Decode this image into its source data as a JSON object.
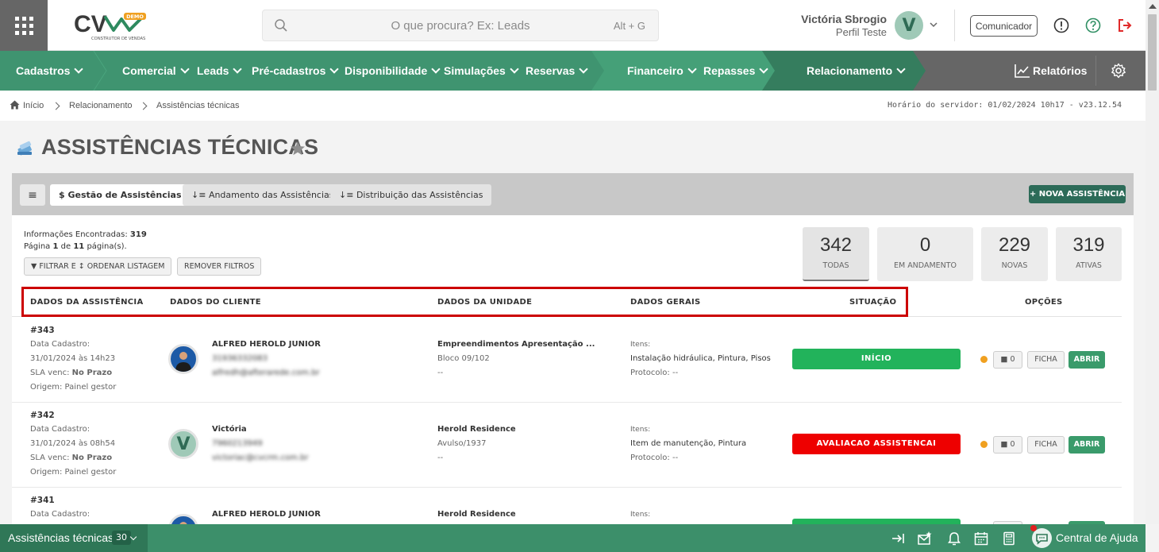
{
  "header": {
    "logo_text": "CV",
    "logo_badge": "DEMO",
    "logo_subtitle": "CONSTRUTOR DE VENDAS",
    "search_placeholder": "O que procura? Ex: Leads",
    "search_shortcut": "Alt + G",
    "user_name": "Victória Sbrogio",
    "user_profile": "Perfil Teste",
    "avatar_letter": "V",
    "communicator_label": "Comunicador"
  },
  "nav": {
    "items": [
      "Cadastros",
      "Comercial",
      "Leads",
      "Pré-cadastros",
      "Disponibilidade",
      "Simulações",
      "Reservas",
      "Financeiro",
      "Repasses",
      "Relacionamento"
    ],
    "reports_label": "Relatórios",
    "colors": {
      "green_main": "#3f9470",
      "green_light": "#45a078",
      "green_dark": "#357d5e",
      "gray": "#666666"
    }
  },
  "breadcrumb": {
    "items": [
      "Início",
      "Relacionamento",
      "Assistências técnicas"
    ],
    "server_time": "Horário do servidor: 01/02/2024 10h17 - v23.12.54"
  },
  "page": {
    "title": "ASSISTÊNCIAS TÉCNICAS"
  },
  "tabs": {
    "items": [
      "$ Gestão de Assistências",
      "Andamento das Assistências",
      "Distribuição das Assistências"
    ],
    "new_button": "+ NOVA ASSISTÊNCIA"
  },
  "summary": {
    "found_label": "Informações Encontradas:",
    "found_count": "319",
    "page_word": "Página",
    "page_current": "1",
    "of_word": "de",
    "page_total": "11",
    "pages_suffix": "página(s).",
    "filter_button": "FILTRAR E ↕ ORDENAR LISTAGEM",
    "remove_filters": "REMOVER FILTROS"
  },
  "stats": [
    {
      "value": "342",
      "label": "TODAS"
    },
    {
      "value": "0",
      "label": "EM ANDAMENTO"
    },
    {
      "value": "229",
      "label": "NOVAS"
    },
    {
      "value": "319",
      "label": "ATIVAS"
    }
  ],
  "table": {
    "headers": {
      "assistance": "DADOS DA ASSISTÊNCIA",
      "client": "DADOS DO CLIENTE",
      "unit": "DADOS DA UNIDADE",
      "general": "DADOS GERAIS",
      "status": "SITUAÇÃO",
      "options": "OPÇÕES"
    },
    "labels": {
      "cadastro": "Data Cadastro:",
      "sla": "SLA venc:",
      "items": "Itens:",
      "protocol": "Protocolo:",
      "ficha": "FICHA",
      "abrir": "ABRIR"
    },
    "rows": [
      {
        "id": "#343",
        "date": "31/01/2024 às 14h23",
        "sla": "No Prazo",
        "origin": "Origem: Painel gestor",
        "client_name": "ALFRED HEROLD JUNIOR",
        "client_phone": "31936332083",
        "client_email": "alfredh@afterarede.com.br",
        "avatar": "photo",
        "unit_name": "Empreendimentos Apresentação ...",
        "unit_block": "Bloco 09/102",
        "unit_extra": "--",
        "items": "Instalação hidráulica, Pintura, Pisos",
        "protocol": "--",
        "status": "INÍCIO",
        "status_color": "#22b35b",
        "comments": "0"
      },
      {
        "id": "#342",
        "date": "31/01/2024 às 08h54",
        "sla": "No Prazo",
        "origin": "Origem: Painel gestor",
        "client_name": "Victória",
        "client_phone": "7960213949",
        "client_email": "victoriac@cvcrm.com.br",
        "avatar": "V",
        "unit_name": "Herold Residence",
        "unit_block": "Avulso/1937",
        "unit_extra": "--",
        "items": "Item de manutenção, Pintura",
        "protocol": "--",
        "status": "AVALIACAO ASSISTENCAI",
        "status_color": "#ee0000",
        "comments": "0"
      },
      {
        "id": "#341",
        "date": "",
        "sla": "",
        "origin": "",
        "client_name": "ALFRED HEROLD JUNIOR",
        "client_phone": "",
        "client_email": "",
        "avatar": "photo",
        "unit_name": "Herold Residence",
        "unit_block": "",
        "unit_extra": "",
        "items": "",
        "protocol": "",
        "status": "",
        "status_color": "#22b35b",
        "comments": ""
      }
    ]
  },
  "footer": {
    "title": "Assistências técnicas",
    "count": "30",
    "help_label": "Central de Ajuda"
  }
}
